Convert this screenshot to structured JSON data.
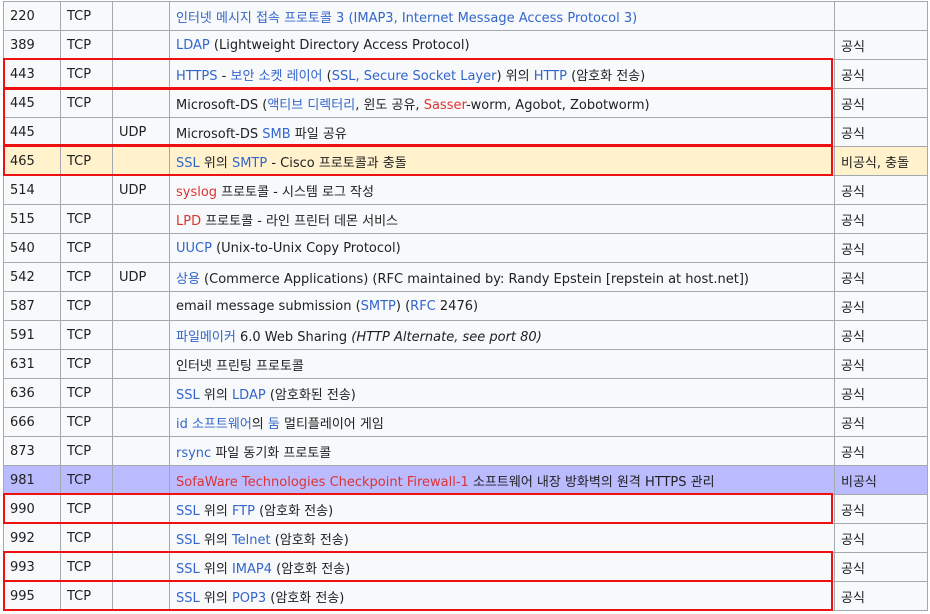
{
  "rows": [
    {
      "port": "220",
      "tcp": "TCP",
      "udp": "",
      "desc": [
        {
          "t": "인터넷 메시지 접속 프로토콜 3 (IMAP3, Internet Message Access Protocol 3)",
          "c": "b"
        }
      ],
      "status": ""
    },
    {
      "port": "389",
      "tcp": "TCP",
      "udp": "",
      "desc": [
        {
          "t": "LDAP",
          "c": "b"
        },
        {
          "t": " (Lightweight Directory Access Protocol)"
        }
      ],
      "status": "공식"
    },
    {
      "port": "443",
      "tcp": "TCP",
      "udp": "",
      "desc": [
        {
          "t": "HTTPS",
          "c": "b"
        },
        {
          "t": " - "
        },
        {
          "t": "보안 소켓 레이어",
          "c": "b"
        },
        {
          "t": " ("
        },
        {
          "t": "SSL, Secure Socket Layer",
          "c": "b"
        },
        {
          "t": ") 위의 "
        },
        {
          "t": "HTTP",
          "c": "b"
        },
        {
          "t": " (암호화 전송)"
        }
      ],
      "status": "공식"
    },
    {
      "port": "445",
      "tcp": "TCP",
      "udp": "",
      "desc": [
        {
          "t": "Microsoft-DS ("
        },
        {
          "t": "액티브 디렉터리",
          "c": "b"
        },
        {
          "t": ", 윈도 공유, "
        },
        {
          "t": "Sasser",
          "c": "r"
        },
        {
          "t": "-worm, Agobot, Zobotworm)"
        }
      ],
      "status": "공식"
    },
    {
      "port": "445",
      "tcp": "",
      "udp": "UDP",
      "desc": [
        {
          "t": "Microsoft-DS "
        },
        {
          "t": "SMB",
          "c": "b"
        },
        {
          "t": " 파일 공유"
        }
      ],
      "status": "공식"
    },
    {
      "port": "465",
      "tcp": "TCP",
      "udp": "",
      "desc": [
        {
          "t": "SSL",
          "c": "b"
        },
        {
          "t": " 위의 "
        },
        {
          "t": "SMTP",
          "c": "b"
        },
        {
          "t": " - Cisco 프로토콜과 충돌"
        }
      ],
      "status": "비공식, 충돌",
      "row": "yellow"
    },
    {
      "port": "514",
      "tcp": "",
      "udp": "UDP",
      "desc": [
        {
          "t": "syslog",
          "c": "r"
        },
        {
          "t": " 프로토콜 - 시스템 로그 작성"
        }
      ],
      "status": "공식"
    },
    {
      "port": "515",
      "tcp": "TCP",
      "udp": "",
      "desc": [
        {
          "t": "LPD",
          "c": "r"
        },
        {
          "t": " 프로토콜 - 라인 프린터 데몬 서비스"
        }
      ],
      "status": "공식"
    },
    {
      "port": "540",
      "tcp": "TCP",
      "udp": "",
      "desc": [
        {
          "t": "UUCP",
          "c": "b"
        },
        {
          "t": " (Unix-to-Unix Copy Protocol)"
        }
      ],
      "status": "공식"
    },
    {
      "port": "542",
      "tcp": "TCP",
      "udp": "UDP",
      "desc": [
        {
          "t": "상용",
          "c": "b"
        },
        {
          "t": " (Commerce Applications) (RFC maintained by: Randy Epstein [repstein at host.net])"
        }
      ],
      "status": "공식"
    },
    {
      "port": "587",
      "tcp": "TCP",
      "udp": "",
      "desc": [
        {
          "t": "email message submission ("
        },
        {
          "t": "SMTP",
          "c": "b"
        },
        {
          "t": ") ("
        },
        {
          "t": "RFC",
          "c": "b"
        },
        {
          "t": " 2476)"
        }
      ],
      "status": "공식"
    },
    {
      "port": "591",
      "tcp": "TCP",
      "udp": "",
      "desc": [
        {
          "t": "파일메이커",
          "c": "b"
        },
        {
          "t": " 6.0 Web Sharing "
        },
        {
          "t": "(HTTP Alternate, see port 80)",
          "c": "i"
        }
      ],
      "status": "공식"
    },
    {
      "port": "631",
      "tcp": "TCP",
      "udp": "",
      "desc": [
        {
          "t": "인터넷 프린팅 프로토콜"
        }
      ],
      "status": "공식"
    },
    {
      "port": "636",
      "tcp": "TCP",
      "udp": "",
      "desc": [
        {
          "t": "SSL",
          "c": "b"
        },
        {
          "t": " 위의 "
        },
        {
          "t": "LDAP",
          "c": "b"
        },
        {
          "t": " (암호화된 전송)"
        }
      ],
      "status": "공식"
    },
    {
      "port": "666",
      "tcp": "TCP",
      "udp": "",
      "desc": [
        {
          "t": "id 소프트웨어",
          "c": "b"
        },
        {
          "t": "의 "
        },
        {
          "t": "둠",
          "c": "b"
        },
        {
          "t": " 멀티플레이어 게임"
        }
      ],
      "status": "공식"
    },
    {
      "port": "873",
      "tcp": "TCP",
      "udp": "",
      "desc": [
        {
          "t": "rsync",
          "c": "b"
        },
        {
          "t": " 파일 동기화 프로토콜"
        }
      ],
      "status": "공식"
    },
    {
      "port": "981",
      "tcp": "TCP",
      "udp": "",
      "desc": [
        {
          "t": "SofaWare Technologies Checkpoint Firewall-1",
          "c": "r"
        },
        {
          "t": " 소프트웨어 내장 방화벽의 원격 HTTPS 관리"
        }
      ],
      "status": "비공식",
      "row": "purple"
    },
    {
      "port": "990",
      "tcp": "TCP",
      "udp": "",
      "desc": [
        {
          "t": "SSL",
          "c": "b"
        },
        {
          "t": " 위의 "
        },
        {
          "t": "FTP",
          "c": "b"
        },
        {
          "t": " (암호화 전송)"
        }
      ],
      "status": "공식"
    },
    {
      "port": "992",
      "tcp": "TCP",
      "udp": "",
      "desc": [
        {
          "t": "SSL",
          "c": "b"
        },
        {
          "t": " 위의 "
        },
        {
          "t": "Telnet",
          "c": "b"
        },
        {
          "t": " (암호화 전송)"
        }
      ],
      "status": "공식"
    },
    {
      "port": "993",
      "tcp": "TCP",
      "udp": "",
      "desc": [
        {
          "t": "SSL",
          "c": "b"
        },
        {
          "t": " 위의 "
        },
        {
          "t": "IMAP4",
          "c": "b"
        },
        {
          "t": " (암호화 전송)"
        }
      ],
      "status": "공식"
    },
    {
      "port": "995",
      "tcp": "TCP",
      "udp": "",
      "desc": [
        {
          "t": "SSL",
          "c": "b"
        },
        {
          "t": " 위의 "
        },
        {
          "t": "POP3",
          "c": "b"
        },
        {
          "t": " (암호화 전송)"
        }
      ],
      "status": "공식"
    }
  ],
  "highlight_color": "#ee1111"
}
